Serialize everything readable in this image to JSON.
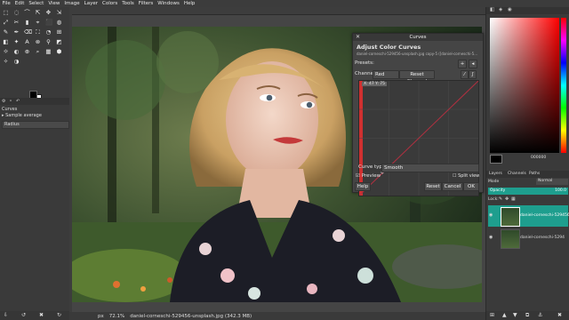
{
  "menu": [
    "File",
    "Edit",
    "Select",
    "View",
    "Image",
    "Layer",
    "Colors",
    "Tools",
    "Filters",
    "Windows",
    "Help"
  ],
  "toolbox": {
    "tools": [
      "⬚",
      "◌",
      "⌒",
      "⇱",
      "✥",
      "⇲",
      "⤢",
      "✂",
      "▮",
      "⌖",
      "⬛",
      "◍",
      "✎",
      "✒",
      "⌫",
      "⛶",
      "◔",
      "⊞",
      "◧",
      "✦",
      "A",
      "⊗",
      "⚲",
      "◩",
      "☼",
      "◐",
      "⊕",
      "⌕",
      "▦",
      "⬢",
      "✧",
      "◑"
    ],
    "fg_color": "#000000",
    "bg_color": "#ffffff",
    "options_title": "Curves",
    "sample_average": "Sample average",
    "radius_label": "Radius"
  },
  "dialog": {
    "window_title": "Curves",
    "heading": "Adjust Color Curves",
    "subheading": "daniel-corneschi-529456-unsplash.jpg copy-5 ([daniel-corneschi-5...",
    "presets_label": "Presets:",
    "channel_label": "Channel:",
    "channel_value": "Red",
    "reset_channel": "Reset Channel",
    "readout": "X: 47  Y: 75",
    "curve_type_label": "Curve type:",
    "curve_type_value": "Smooth",
    "preview_label": "Preview",
    "split_view_label": "Split view",
    "help": "Help",
    "reset": "Reset",
    "cancel": "Cancel",
    "ok": "OK"
  },
  "layers_panel": {
    "tabs": [
      "Layers",
      "Channels",
      "Paths"
    ],
    "mode_label": "Mode",
    "mode_value": "Normal",
    "opacity_label": "Opacity",
    "opacity_value": "100.0",
    "lock_label": "Lock:",
    "layers": [
      {
        "name": "daniel-corneschi-529456",
        "selected": true
      },
      {
        "name": "daniel-corneschi-5294",
        "selected": false
      }
    ]
  },
  "color_panel": {
    "hex_value": "000000"
  },
  "status": {
    "unit": "px",
    "zoom": "72.1%",
    "filename": "daniel-corneschi-529456-unsplash.jpg (342.3 MB)"
  },
  "colors": {
    "accent": "#1e9e8e",
    "curve_red": "#c0212b"
  }
}
